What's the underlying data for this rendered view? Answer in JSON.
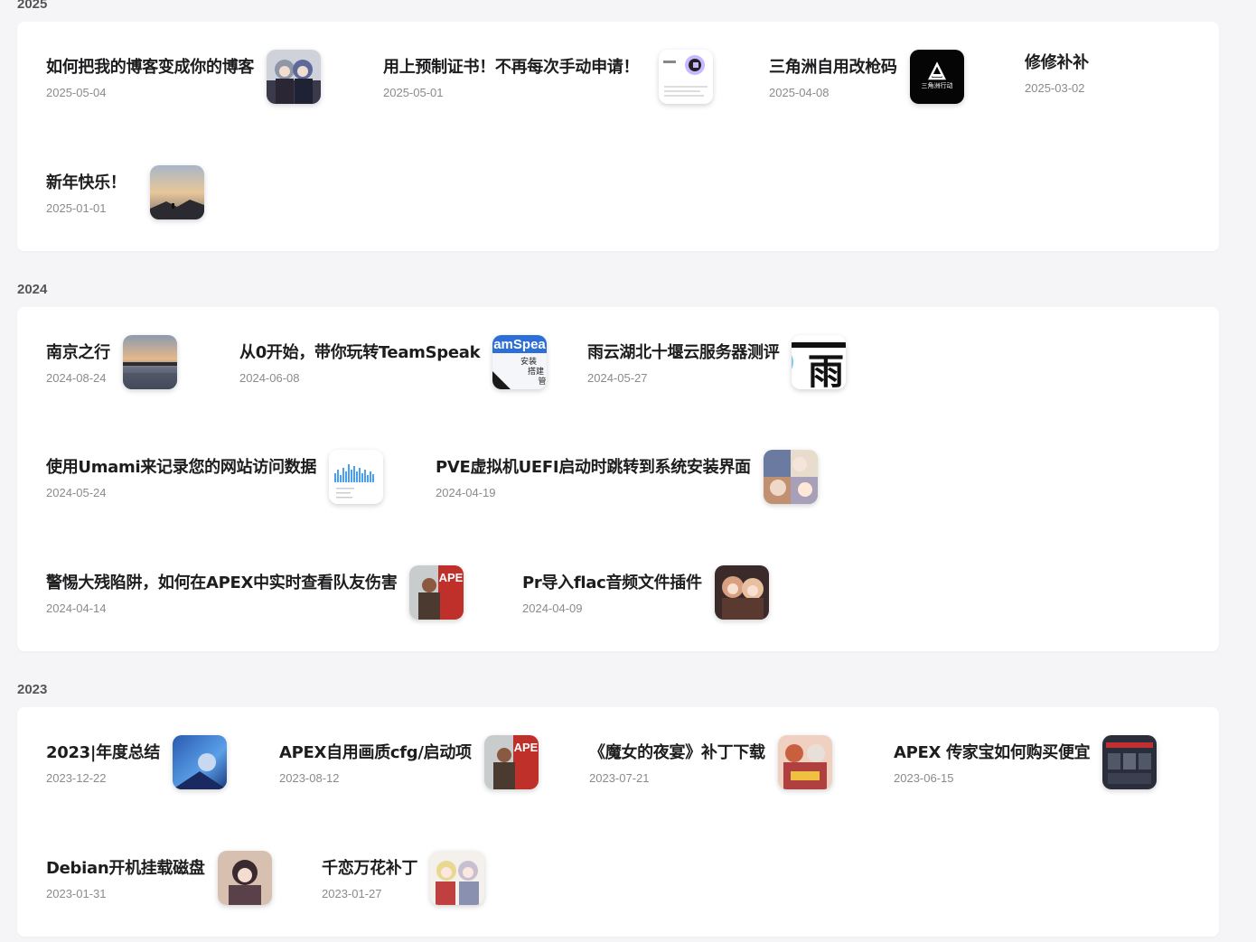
{
  "sections": [
    {
      "year": "2025",
      "posts": [
        {
          "title": "如何把我的博客变成你的博客",
          "date": "2025-05-04",
          "thumb": "anime-girls-thumbnail"
        },
        {
          "title": "用上预制证书！不再每次手动申请！",
          "date": "2025-05-01",
          "thumb": "certificate-app-thumbnail"
        },
        {
          "title": "三角洲自用改枪码",
          "date": "2025-04-08",
          "thumb": "delta-force-logo-thumbnail",
          "thumb_text": "三角洲行动"
        },
        {
          "title": "修修补补",
          "date": "2025-03-02"
        },
        {
          "title": "新年快乐！",
          "date": "2025-01-01",
          "thumb": "sunset-landscape-thumbnail"
        }
      ]
    },
    {
      "year": "2024",
      "posts": [
        {
          "title": "南京之行",
          "date": "2024-08-24",
          "thumb": "lake-sunset-thumbnail"
        },
        {
          "title": "从0开始，带你玩转TeamSpeak",
          "date": "2024-06-08",
          "thumb": "teamspeak-banner-thumbnail",
          "thumb_text": "amSpea",
          "thumb_sub1": "安装",
          "thumb_sub2": "搭建",
          "thumb_sub3": "管"
        },
        {
          "title": "雨云湖北十堰云服务器测评",
          "date": "2024-05-27",
          "thumb": "rainyun-logo-thumbnail",
          "thumb_text": "雨"
        },
        {
          "title": "使用Umami来记录您的网站访问数据",
          "date": "2024-05-24",
          "thumb": "analytics-chart-thumbnail"
        },
        {
          "title": "PVE虚拟机UEFI启动时跳转到系统安装界面",
          "date": "2024-04-19",
          "thumb": "anime-collage-thumbnail"
        },
        {
          "title": "警惕大残陷阱，如何在APEX中实时查看队友伤害",
          "date": "2024-04-14",
          "thumb": "apex-legends-thumbnail",
          "thumb_text": "APE"
        },
        {
          "title": "Pr导入flac音频文件插件",
          "date": "2024-04-09",
          "thumb": "anime-character-thumbnail"
        }
      ]
    },
    {
      "year": "2023",
      "posts": [
        {
          "title": "2023|年度总结",
          "date": "2023-12-22",
          "thumb": "blue-anime-scene-thumbnail"
        },
        {
          "title": "APEX自用画质cfg/启动项",
          "date": "2023-08-12",
          "thumb": "apex-legends-thumbnail",
          "thumb_text": "APE"
        },
        {
          "title": "《魔女的夜宴》补丁下载",
          "date": "2023-07-21",
          "thumb": "visual-novel-cover-thumbnail"
        },
        {
          "title": "APEX 传家宝如何购买便宜",
          "date": "2023-06-15",
          "thumb": "apex-store-thumbnail"
        },
        {
          "title": "Debian开机挂载磁盘",
          "date": "2023-01-31",
          "thumb": "anime-portrait-thumbnail"
        },
        {
          "title": "千恋万花补丁",
          "date": "2023-01-27",
          "thumb": "anime-duo-thumbnail"
        }
      ]
    }
  ]
}
